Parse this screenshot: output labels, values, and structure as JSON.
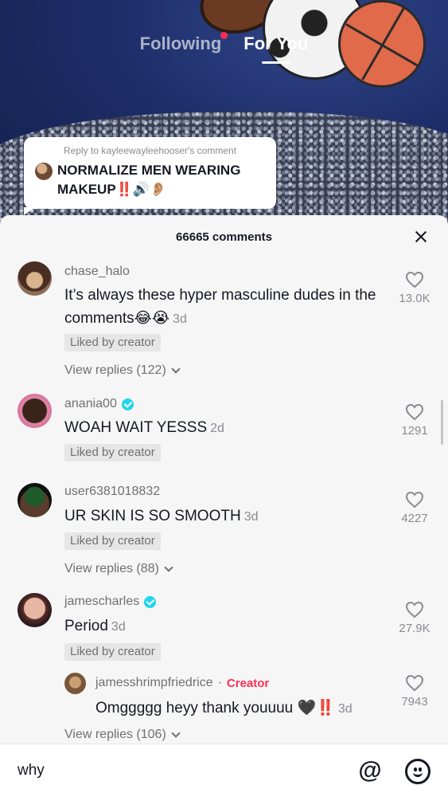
{
  "top_nav": {
    "following_label": "Following",
    "for_you_label": "For You"
  },
  "reply_sticker": {
    "header": "Reply to kayleewayleehooser's comment",
    "text": "NORMALIZE MEN WEARING MAKEUP‼️🔊👂🏼"
  },
  "comments_sheet": {
    "title": "66665 comments",
    "comments": [
      {
        "username": "chase_halo",
        "text": "It’s always these hyper masculine dudes in the comments😂😭",
        "time": "3d",
        "liked_badge": "Liked by creator",
        "likes": "13.0K",
        "view_replies": "View replies (122)"
      },
      {
        "username": "anania00",
        "verified": true,
        "text": "WOAH WAIT YESSS",
        "time": "2d",
        "liked_badge": "Liked by creator",
        "likes": "1291"
      },
      {
        "username": "user6381018832",
        "text": "UR SKIN IS SO SMOOTH",
        "time": "3d",
        "liked_badge": "Liked by creator",
        "likes": "4227",
        "view_replies": "View replies (88)"
      },
      {
        "username": "jamescharles",
        "verified": true,
        "text": "Period",
        "time": "3d",
        "liked_badge": "Liked by creator",
        "likes": "27.9K"
      }
    ],
    "creator_reply": {
      "username": "jamesshrimpfriedrice",
      "separator": "·",
      "creator_label": "Creator",
      "text": "Omggggg heyy thank youuuu 🖤‼️",
      "time": "3d",
      "likes": "7943"
    },
    "more_replies": "View replies (106)"
  },
  "input_bar": {
    "value": "why"
  },
  "colors": {
    "accent_red": "#fe2c55",
    "verified_blue": "#20d5ec",
    "sheet_bg": "#f6f6f6"
  }
}
